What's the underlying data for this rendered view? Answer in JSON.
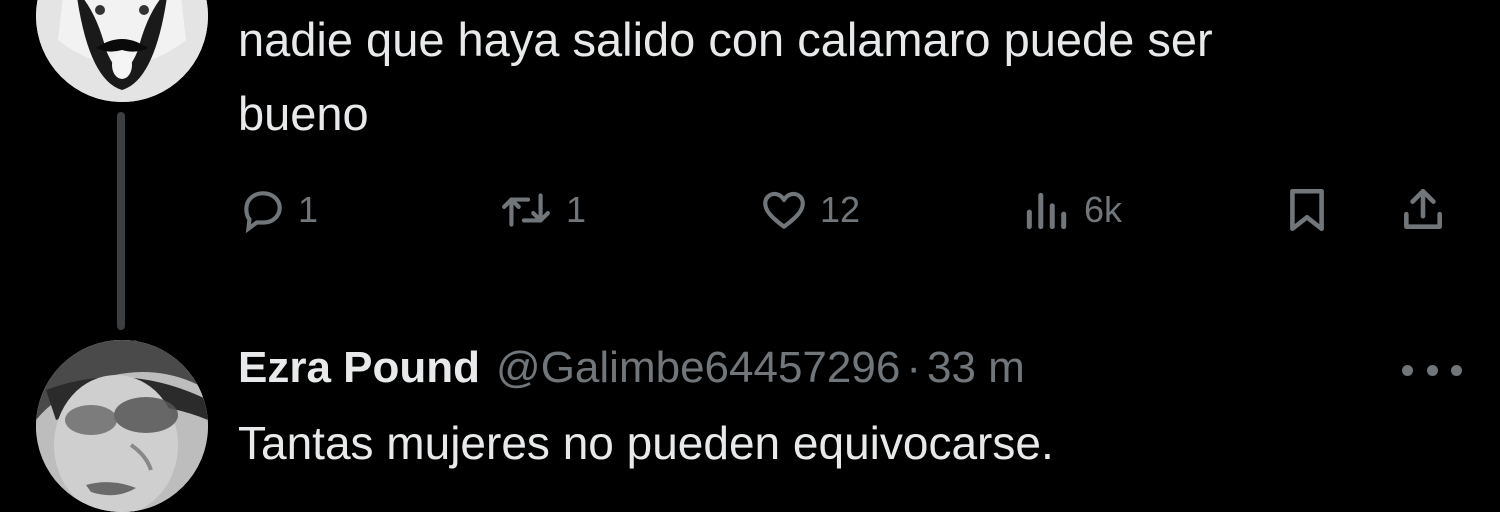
{
  "thread": {
    "parent": {
      "text_line_1": "nadie que haya salido con calamaro puede ser",
      "text_line_2": "bueno",
      "actions": {
        "reply_count": "1",
        "retweet_count": "1",
        "like_count": "12",
        "views_count": "6k"
      }
    },
    "reply": {
      "author_name": "Ezra Pound",
      "author_handle": "@Galimbe64457296",
      "separator": "·",
      "timestamp": "33 m",
      "text": "Tantas mujeres no pueden equivocarse."
    }
  },
  "icons": {
    "reply": "reply-icon",
    "retweet": "retweet-icon",
    "like": "heart-icon",
    "views": "views-icon",
    "bookmark": "bookmark-icon",
    "share": "share-icon",
    "more": "more-icon"
  },
  "colors": {
    "background": "#000000",
    "text_primary": "#e7e9ea",
    "text_secondary": "#71767b",
    "thread_line": "#3c3f42"
  }
}
